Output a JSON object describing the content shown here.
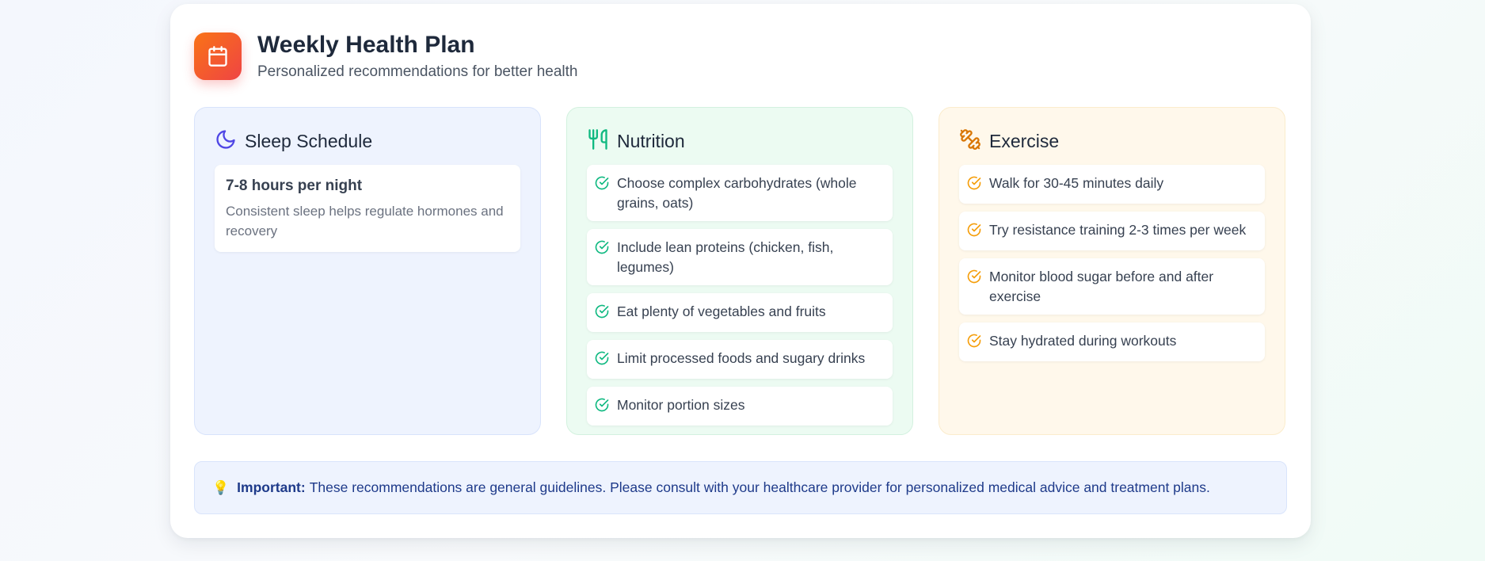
{
  "header": {
    "icon": "calendar-icon",
    "title": "Weekly Health Plan",
    "subtitle": "Personalized recommendations for better health"
  },
  "sleep": {
    "icon": "moon-icon",
    "title": "Sleep Schedule",
    "hours": "7-8 hours per night",
    "description": "Consistent sleep helps regulate hormones and recovery"
  },
  "nutrition": {
    "icon": "utensils-icon",
    "title": "Nutrition",
    "items": [
      "Choose complex carbohydrates (whole grains, oats)",
      "Include lean proteins (chicken, fish, legumes)",
      "Eat plenty of vegetables and fruits",
      "Limit processed foods and sugary drinks",
      "Monitor portion sizes"
    ]
  },
  "exercise": {
    "icon": "dumbbell-icon",
    "title": "Exercise",
    "items": [
      "Walk for 30-45 minutes daily",
      "Try resistance training 2-3 times per week",
      "Monitor blood sugar before and after exercise",
      "Stay hydrated during workouts"
    ]
  },
  "notice": {
    "icon": "lightbulb-icon",
    "label": "Important:",
    "text": "These recommendations are general guidelines. Please consult with your healthcare provider for personalized medical advice and treatment plans."
  },
  "colors": {
    "accent_orange": "#f97316",
    "accent_red": "#ef4444",
    "sleep_icon": "#4f46e5",
    "nutrition_icon": "#10b981",
    "exercise_icon": "#f59e0b",
    "notice_text": "#1e3a8a"
  }
}
